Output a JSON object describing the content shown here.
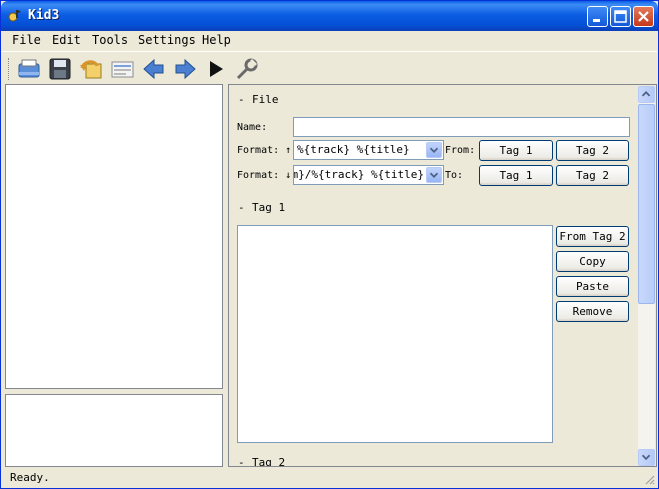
{
  "window": {
    "title": "Kid3"
  },
  "menu": [
    "File",
    "Edit",
    "Tools",
    "Settings",
    "Help"
  ],
  "toolbar": {
    "icons": [
      "open-folder-icon",
      "save-icon",
      "revert-icon",
      "playlist-icon",
      "previous-icon",
      "next-icon",
      "play-icon",
      "settings-icon"
    ]
  },
  "file_section": {
    "title": "File",
    "toggle": "-",
    "name_label": "Name:",
    "name_value": "",
    "format_up_label": "Format: ↑",
    "format_up_value": "%{track} %{title}",
    "from_label": "From:",
    "format_down_label": "Format: ↓",
    "format_down_value": "%{album}/%{track} %{title}",
    "to_label": "To:",
    "tag1_button": "Tag 1",
    "tag2_button": "Tag 2"
  },
  "tag1_section": {
    "title": "Tag 1",
    "toggle": "-",
    "buttons": {
      "from_tag2": "From Tag 2",
      "copy": "Copy",
      "paste": "Paste",
      "remove": "Remove"
    }
  },
  "tag2_section": {
    "title": "Tag 2",
    "toggle": "-"
  },
  "status": {
    "text": "Ready."
  },
  "colors": {
    "titlebar": "#0a5fe6",
    "face": "#ece9d8",
    "border": "#7f9db9"
  }
}
